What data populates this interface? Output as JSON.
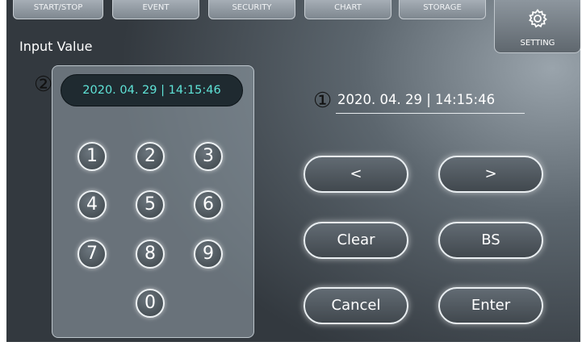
{
  "tabs": [
    {
      "label": "START/STOP"
    },
    {
      "label": "EVENT"
    },
    {
      "label": "SECURITY"
    },
    {
      "label": "CHART"
    },
    {
      "label": "STORAGE"
    }
  ],
  "setting": {
    "label": "SETTING",
    "icon": "gear-icon"
  },
  "page": {
    "title": "Input Value"
  },
  "keypad": {
    "display": "2020. 04. 29  |  14:15:46",
    "marker": "②",
    "keys": [
      "1",
      "2",
      "3",
      "4",
      "5",
      "6",
      "7",
      "8",
      "9",
      "0"
    ]
  },
  "readout": {
    "marker": "①",
    "value": "2020. 04. 29  |  14:15:46"
  },
  "buttons": {
    "prev": "<",
    "next": ">",
    "clear": "Clear",
    "backspace": "BS",
    "cancel": "Cancel",
    "enter": "Enter"
  },
  "colors": {
    "display_text": "#5fe3d7",
    "display_bg": "#1f2a30"
  }
}
